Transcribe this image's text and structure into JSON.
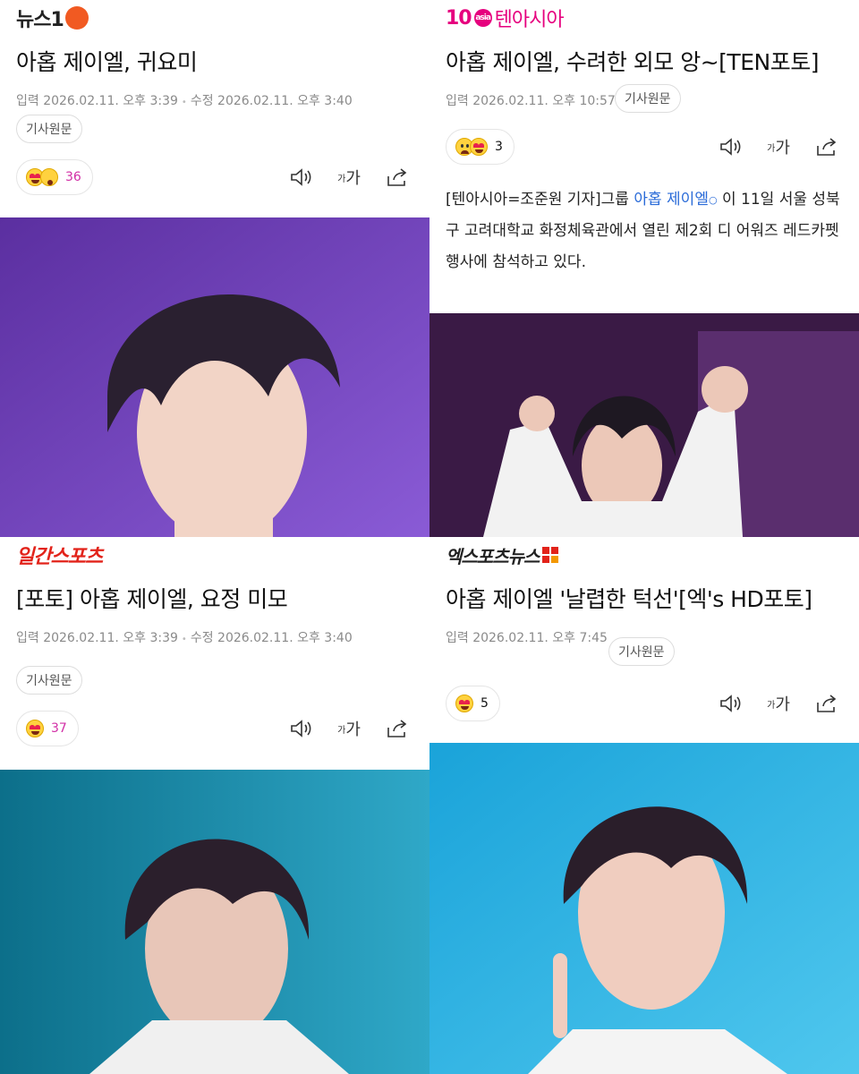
{
  "articles": [
    {
      "publisher": "뉴스1",
      "publisher_color": "#f15a22",
      "title": "아홉 제이엘, 귀요미",
      "meta_published": "입력 2026.02.11. 오후 3:39",
      "meta_edited": "수정 2026.02.11. 오후 3:40",
      "original_label": "기사원문",
      "reaction_count": "36",
      "reaction_count_color": "#d22fa6"
    },
    {
      "publisher": "텐아시아",
      "publisher_badge": "10",
      "publisher_badge_sub": "asia",
      "publisher_color": "#e6007e",
      "title": "아홉 제이엘, 수려한 외모 앙~[TEN포토]",
      "meta_published": "입력 2026.02.11. 오후 10:57",
      "original_label": "기사원문",
      "reaction_count": "3",
      "reaction_count_color": "#333333",
      "body_prefix": "[텐아시아=조준원 기자]그룹",
      "body_link": "아홉 제이엘",
      "body_suffix": "이 11일 서울 성북구 고려대학교 화정체육관에서 열린 제2회 디 어워즈 레드카펫 행사에 참석하고 있다."
    },
    {
      "publisher": "일간스포츠",
      "publisher_color": "#e2231a",
      "title": "[포토] 아홉 제이엘, 요정 미모",
      "meta_published": "입력 2026.02.11. 오후 3:39",
      "meta_edited": "수정 2026.02.11. 오후 3:40",
      "original_label": "기사원문",
      "reaction_count": "37",
      "reaction_count_color": "#d22fa6"
    },
    {
      "publisher": "엑스포츠뉴스",
      "publisher_color": "#e2231a",
      "title": "아홉 제이엘 '날렵한 턱선'[엑's HD포토]",
      "meta_published": "입력 2026.02.11. 오후 7:45",
      "original_label": "기사원문",
      "reaction_count": "5",
      "reaction_count_color": "#333333"
    }
  ],
  "toolbar": {
    "font_small": "가",
    "font_big": "가"
  },
  "icons": [
    "speaker-icon",
    "font-size-icon",
    "share-icon",
    "heart-eyes-emoji",
    "sad-emoji"
  ]
}
